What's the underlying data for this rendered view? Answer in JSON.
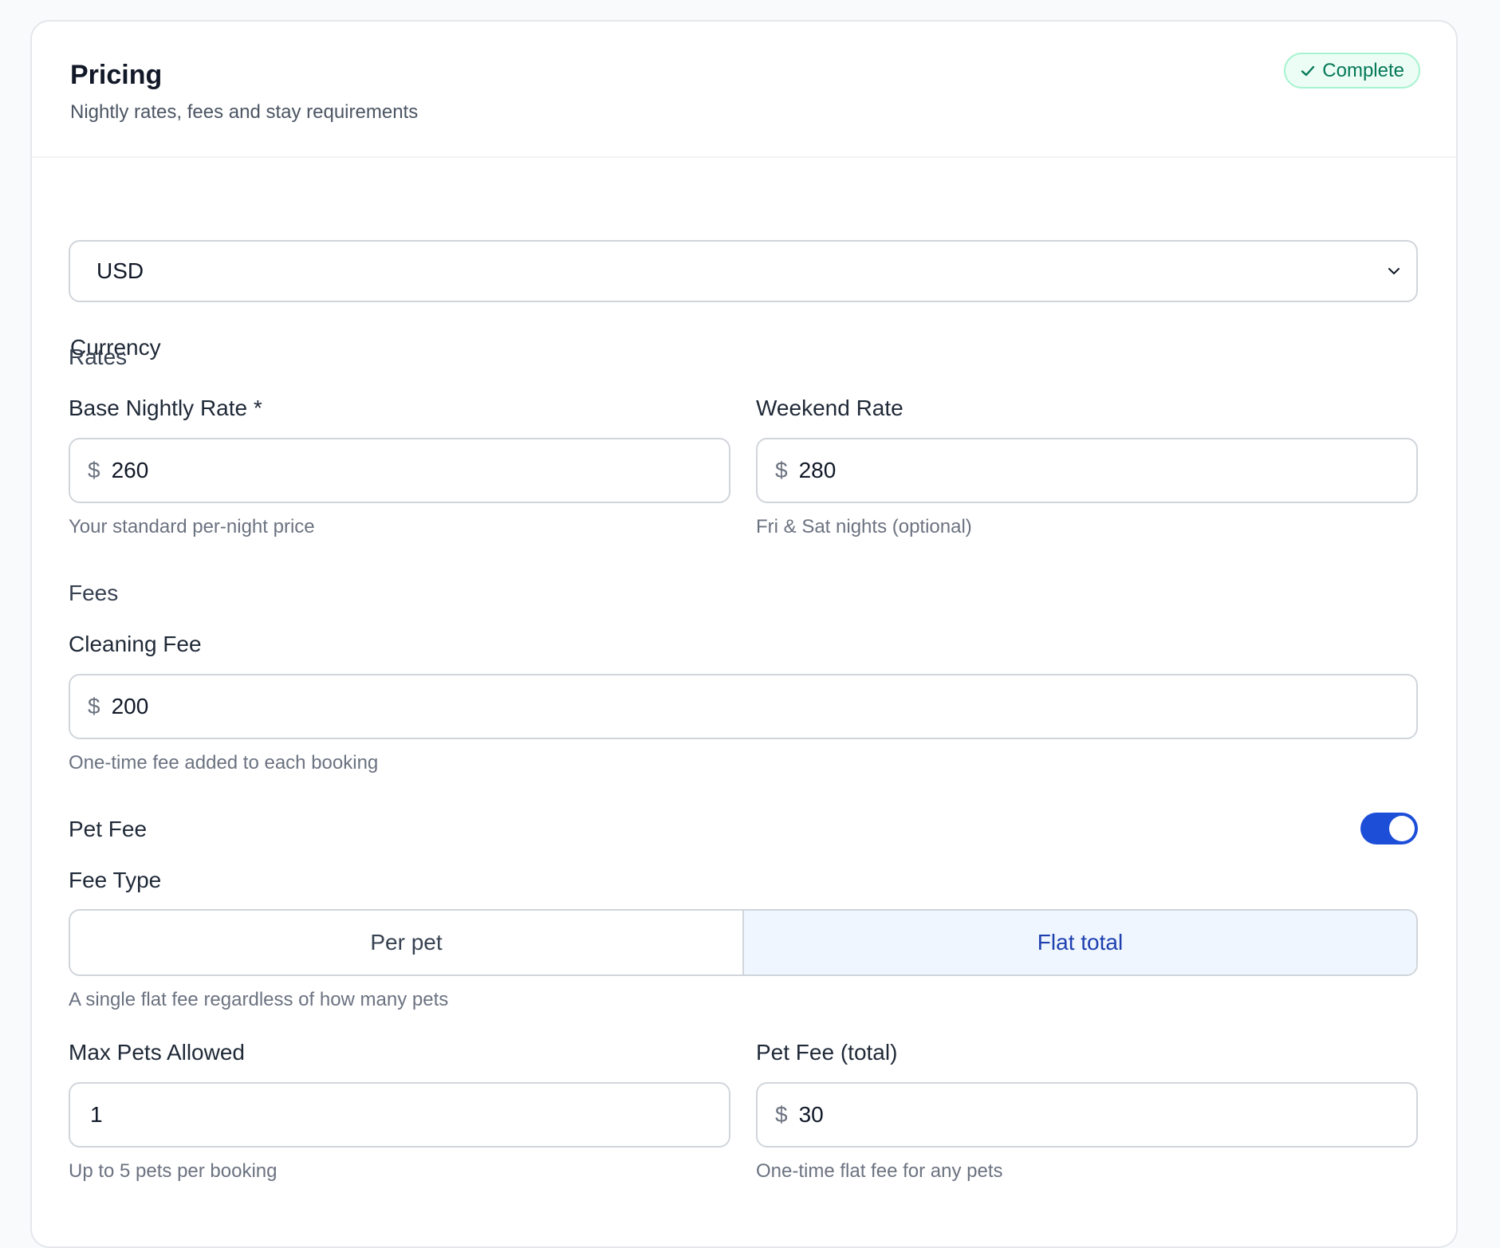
{
  "header": {
    "title": "Pricing",
    "subtitle": "Nightly rates, fees and stay requirements",
    "status_badge": "Complete"
  },
  "currency": {
    "label": "Currency",
    "value": "USD"
  },
  "rates": {
    "section_label": "Rates",
    "base_nightly": {
      "label": "Base Nightly Rate *",
      "prefix": "$",
      "value": "260",
      "help": "Your standard per-night price"
    },
    "weekend": {
      "label": "Weekend Rate",
      "prefix": "$",
      "value": "280",
      "help": "Fri & Sat nights (optional)"
    }
  },
  "fees": {
    "section_label": "Fees",
    "cleaning": {
      "label": "Cleaning Fee",
      "prefix": "$",
      "value": "200",
      "help": "One-time fee added to each booking"
    },
    "pet_fee": {
      "label": "Pet Fee",
      "enabled": true,
      "fee_type_label": "Fee Type",
      "fee_type_options": [
        "Per pet",
        "Flat total"
      ],
      "fee_type_selected": "Flat total",
      "fee_type_help": "A single flat fee regardless of how many pets",
      "max_pets": {
        "label": "Max Pets Allowed",
        "value": "1",
        "help": "Up to 5 pets per booking"
      },
      "total": {
        "label": "Pet Fee (total)",
        "prefix": "$",
        "value": "30",
        "help": "One-time flat fee for any pets"
      }
    }
  },
  "colors": {
    "accent": "#1d4ed8",
    "success_text": "#047857",
    "success_bg": "#ecfdf5"
  }
}
